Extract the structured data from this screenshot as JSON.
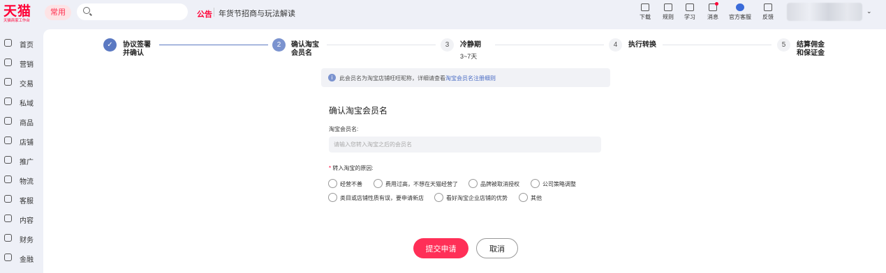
{
  "brand": {
    "logo_text": "天猫",
    "logo_sub": "天猫商家工作台"
  },
  "header": {
    "common_label": "常用",
    "search_placeholder": "",
    "notice_tag": "公告",
    "notice_text": "年货节招商与玩法解读",
    "tools": [
      {
        "label": "下载",
        "icon": "download-icon"
      },
      {
        "label": "规则",
        "icon": "rules-icon"
      },
      {
        "label": "学习",
        "icon": "learn-icon"
      },
      {
        "label": "消息",
        "icon": "message-icon"
      },
      {
        "label": "官方客服",
        "icon": "official-service-icon"
      },
      {
        "label": "反馈",
        "icon": "feedback-icon"
      }
    ],
    "user_caret": "⌄"
  },
  "sidebar": {
    "items": [
      {
        "label": "首页",
        "icon": "home-icon"
      },
      {
        "label": "营销",
        "icon": "marketing-icon"
      },
      {
        "label": "交易",
        "icon": "trade-icon"
      },
      {
        "label": "私域",
        "icon": "private-domain-icon"
      },
      {
        "label": "商品",
        "icon": "goods-icon"
      },
      {
        "label": "店铺",
        "icon": "store-icon"
      },
      {
        "label": "推广",
        "icon": "promotion-icon"
      },
      {
        "label": "物流",
        "icon": "logistics-icon"
      },
      {
        "label": "客服",
        "icon": "customer-service-icon"
      },
      {
        "label": "内容",
        "icon": "content-icon"
      },
      {
        "label": "财务",
        "icon": "finance-icon"
      },
      {
        "label": "金融",
        "icon": "banking-icon"
      }
    ]
  },
  "steps": [
    {
      "number": "✓",
      "title_line1": "协议签署",
      "title_line2": "并确认",
      "sub": "",
      "status": "done"
    },
    {
      "number": "2",
      "title_line1": "确认淘宝",
      "title_line2": "会员名",
      "sub": "",
      "status": "active"
    },
    {
      "number": "3",
      "title_line1": "冷静期",
      "title_line2": "",
      "sub": "3~7天",
      "status": "pending"
    },
    {
      "number": "4",
      "title_line1": "执行转换",
      "title_line2": "",
      "sub": "",
      "status": "pending"
    },
    {
      "number": "5",
      "title_line1": "结算佣金",
      "title_line2": "和保证金",
      "sub": "",
      "status": "pending"
    }
  ],
  "info": {
    "icon": "i",
    "text": "此会员名为淘宝店铺旺旺昵称，详细请查看",
    "link": "淘宝会员名注册细则"
  },
  "form": {
    "title": "确认淘宝会员名",
    "member_label": "淘宝会员名:",
    "member_value": "",
    "member_placeholder": "请输入您转入淘宝之后的会员名",
    "reason_required": "*",
    "reason_label": "转入淘宝的原因:",
    "reasons": [
      "经营不善",
      "费用过高，不想在天猫经营了",
      "品牌被取消授权",
      "公司策略调整",
      "类目或店铺性质有误，要申请新店",
      "看好淘宝企业店铺的优势",
      "其他"
    ]
  },
  "actions": {
    "submit": "提交申请",
    "cancel": "取消"
  },
  "colors": {
    "brand_red": "#ff0036",
    "submit_red": "#ff2f57",
    "step_blue": "#5b79c2",
    "link_blue": "#4a6cc4"
  }
}
